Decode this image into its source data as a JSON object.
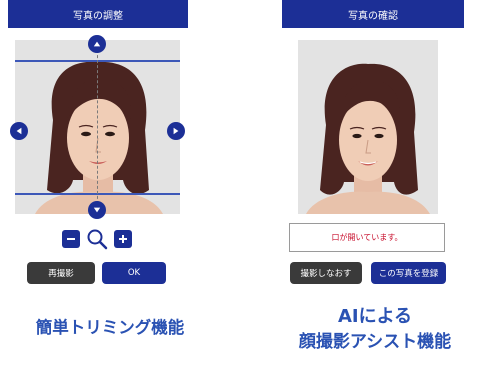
{
  "left_panel": {
    "header_title": "写真の調整",
    "retake_label": "再撮影",
    "ok_label": "OK",
    "caption": "簡単トリミング機能"
  },
  "right_panel": {
    "header_title": "写真の確認",
    "message": "口が開いています。",
    "retake_label": "撮影しなおす",
    "register_label": "この写真を登録",
    "caption_line1": "AIによる",
    "caption_line2": "顔撮影アシスト機能"
  },
  "colors": {
    "brand_blue": "#1c2f96",
    "button_dark": "#3a3a3a",
    "caption_blue": "#2a52b3",
    "alert_red": "#c8102e"
  },
  "icons": [
    "arrow-up-icon",
    "arrow-down-icon",
    "arrow-left-icon",
    "arrow-right-icon",
    "zoom-out-icon",
    "magnifier-icon",
    "zoom-in-icon"
  ]
}
